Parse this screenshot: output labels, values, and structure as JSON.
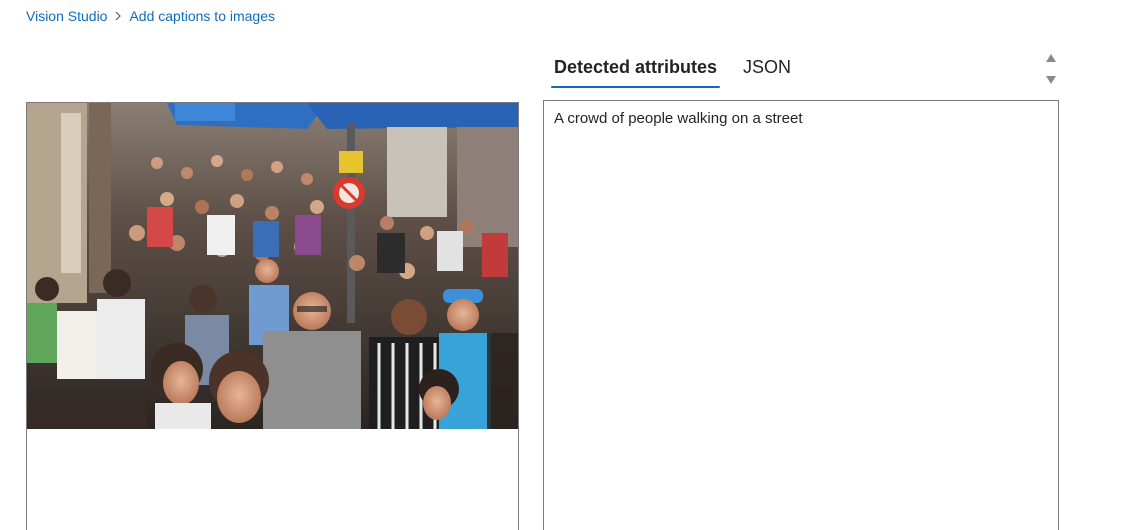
{
  "breadcrumb": {
    "items": [
      {
        "label": "Vision Studio"
      },
      {
        "label": "Add captions to images"
      }
    ],
    "separator_icon": "chevron-right-icon"
  },
  "image_panel": {
    "image_subject": "crowd-street-photo"
  },
  "tabs": {
    "items": [
      {
        "label": "Detected attributes",
        "selected": true
      },
      {
        "label": "JSON",
        "selected": false
      }
    ]
  },
  "scroll": {
    "up_icon": "triangle-up-icon",
    "down_icon": "triangle-down-icon"
  },
  "result": {
    "caption": "A crowd of people walking on a street"
  },
  "colors": {
    "link": "#0f6cbd",
    "tab_indicator": "#0f6cbd",
    "text": "#242424",
    "border": "#7a7a7a"
  }
}
